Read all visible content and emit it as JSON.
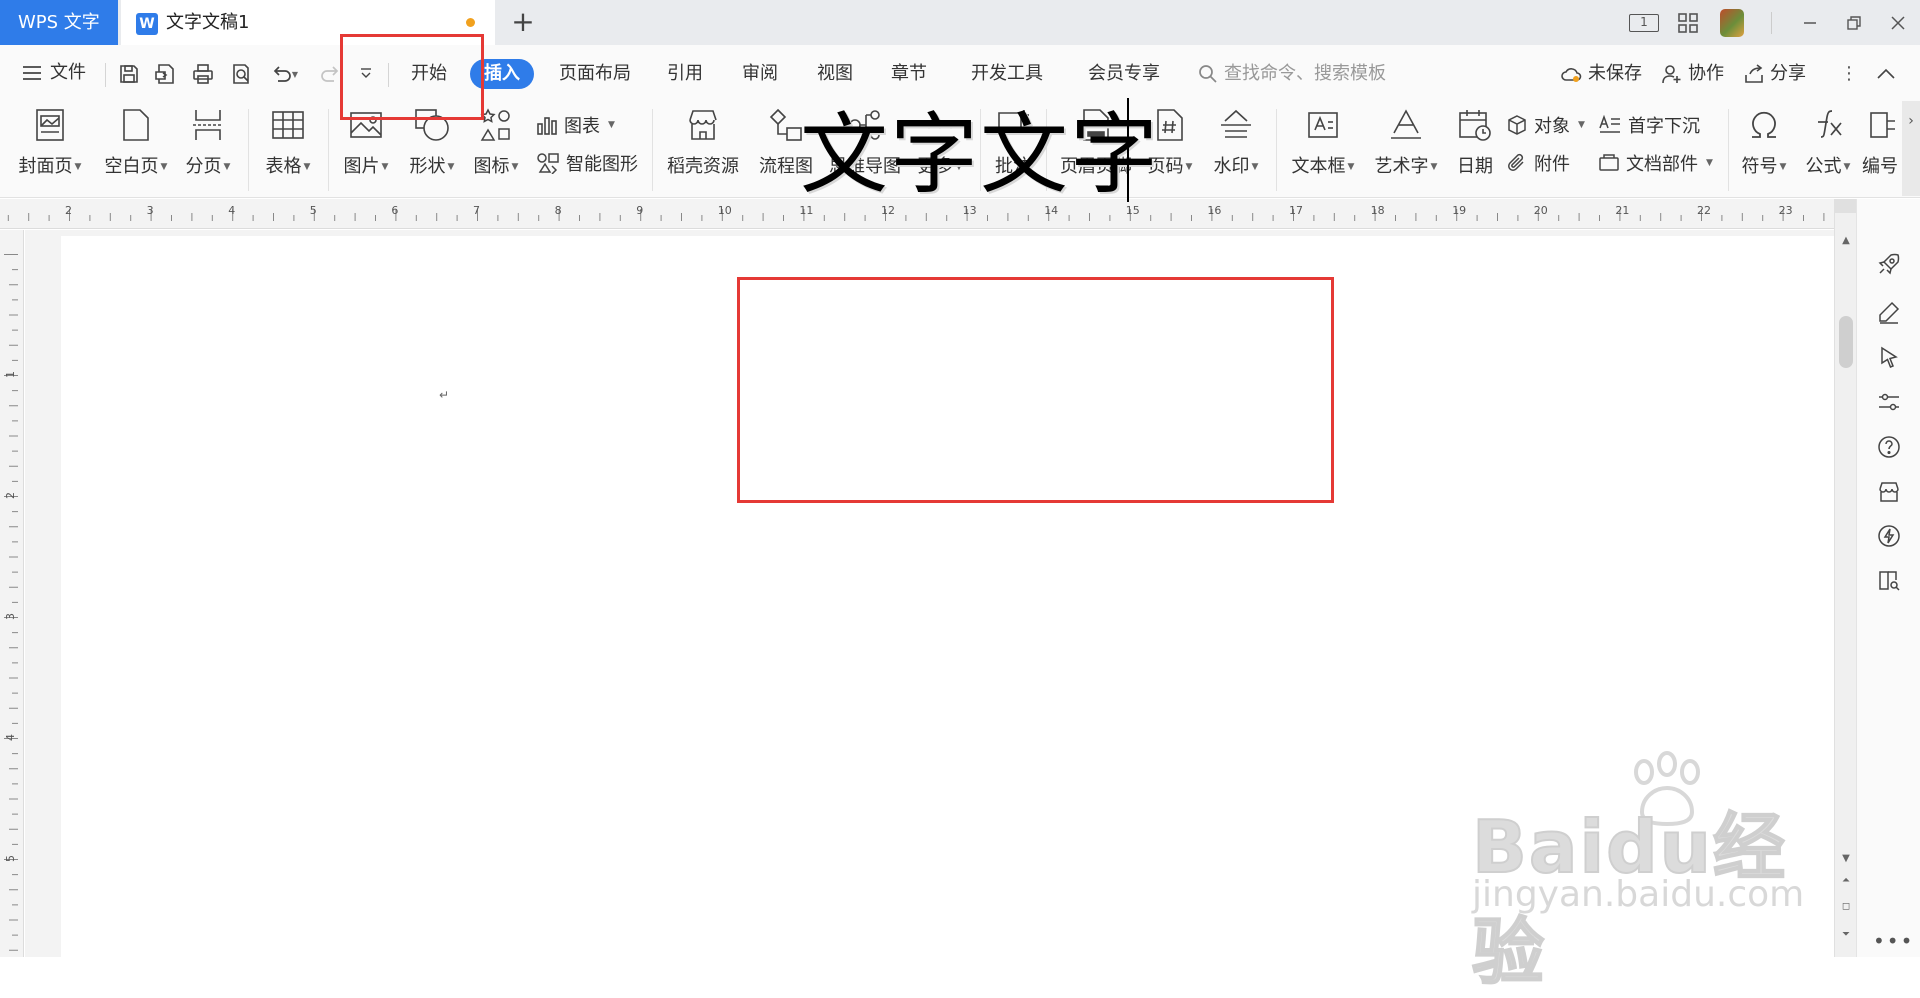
{
  "titlebar": {
    "app_tab": "WPS 文字",
    "doc_tab_title": "文字文稿1",
    "new_tab_glyph": "+",
    "page_badge": "1"
  },
  "menu": {
    "file": "文件",
    "tabs": [
      "开始",
      "插入",
      "页面布局",
      "引用",
      "审阅",
      "视图",
      "章节",
      "开发工具",
      "会员专享"
    ],
    "active_tab": "插入",
    "search_placeholder": "查找命令、搜索模板",
    "unsaved": "未保存",
    "collab": "协作",
    "share": "分享"
  },
  "ribbon": {
    "cover": "封面页",
    "blank": "空白页",
    "pagebreak": "分页",
    "table": "表格",
    "picture": "图片",
    "shape": "形状",
    "icon": "图标",
    "chart": "图表",
    "smartart": "智能图形",
    "daoke": "稻壳资源",
    "flowchart": "流程图",
    "mindmap": "思维导图",
    "more": "更多",
    "comment": "批注",
    "header_footer": "页眉页脚",
    "page_number": "页码",
    "watermark": "水印",
    "textbox": "文本框",
    "wordart": "艺术字",
    "date": "日期",
    "object": "对象",
    "attachment": "附件",
    "dropcap": "首字下沉",
    "docparts": "文档部件",
    "symbol": "符号",
    "formula": "公式",
    "edit": "编号"
  },
  "ruler": {
    "h_numbers": [
      "2",
      "3",
      "4",
      "5",
      "6",
      "7",
      "8",
      "9",
      "10",
      "11",
      "12",
      "13",
      "14",
      "15",
      "16",
      "17",
      "18",
      "19",
      "20",
      "21",
      "22",
      "23"
    ],
    "v_numbers": [
      "1",
      "2",
      "3",
      "4",
      "5"
    ]
  },
  "document": {
    "text": "文字文字"
  },
  "watermark": {
    "brand": "Baidu经验",
    "url": "jingyan.baidu.com"
  },
  "side_panel": {
    "more": "•••"
  },
  "colors": {
    "accent": "#2f7ce9",
    "highlight": "#e53935",
    "unsaved_dot": "#f1a11e"
  }
}
